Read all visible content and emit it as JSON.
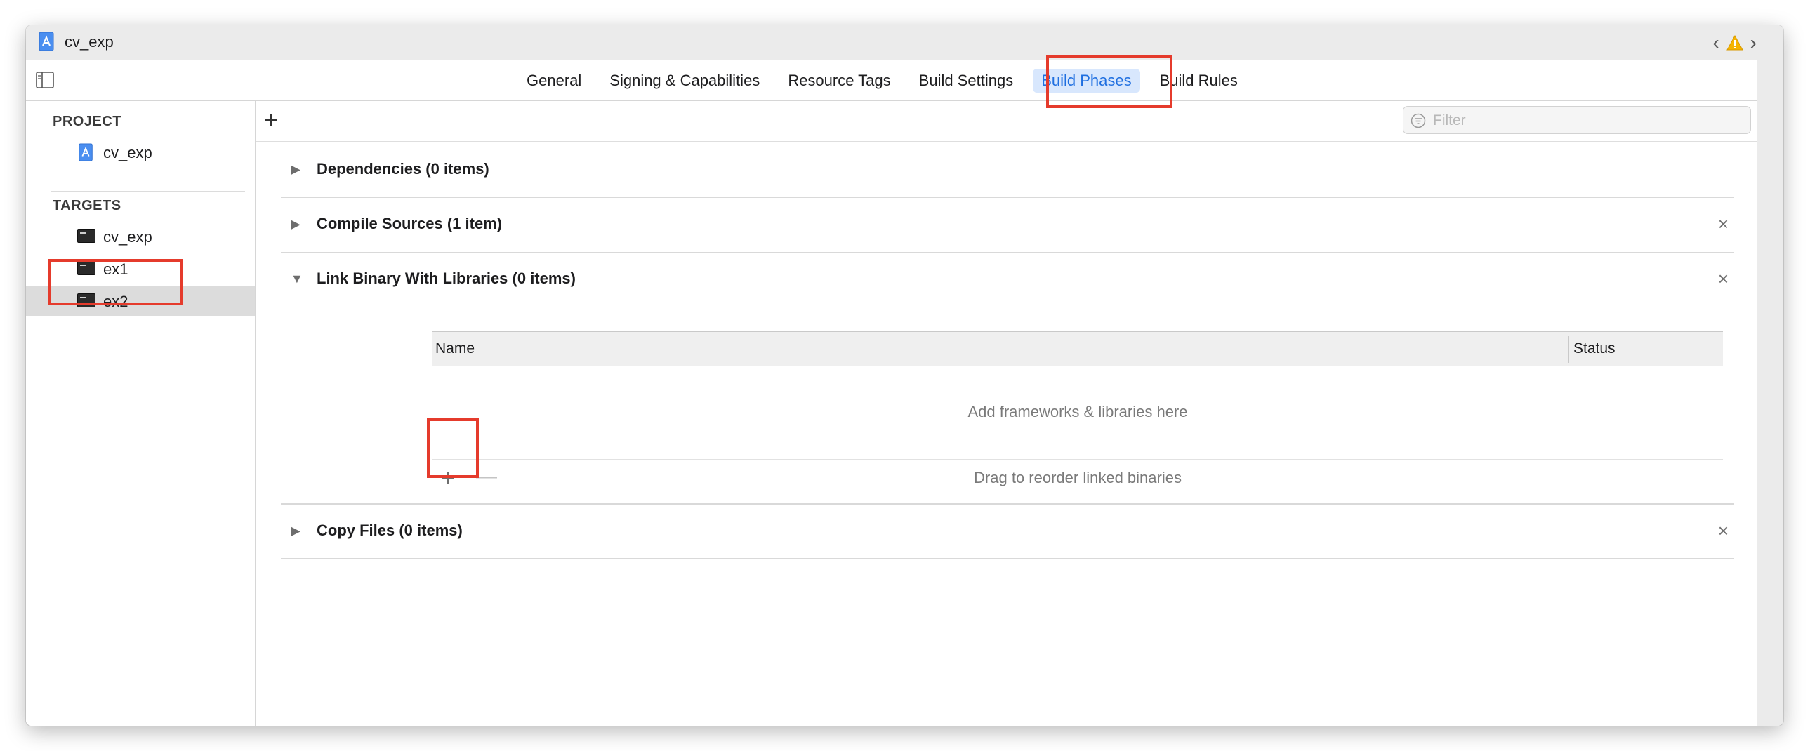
{
  "window": {
    "title": "cv_exp"
  },
  "tabs": [
    {
      "label": "General"
    },
    {
      "label": "Signing & Capabilities"
    },
    {
      "label": "Resource Tags"
    },
    {
      "label": "Build Settings"
    },
    {
      "label": "Build Phases",
      "active": true
    },
    {
      "label": "Build Rules"
    }
  ],
  "sidebar": {
    "project_header": "PROJECT",
    "project_item": {
      "label": "cv_exp",
      "icon": "xcode-project-icon"
    },
    "targets_header": "TARGETS",
    "targets": [
      {
        "label": "cv_exp",
        "icon": "terminal-target-icon"
      },
      {
        "label": "ex1",
        "icon": "terminal-target-icon"
      },
      {
        "label": "ex2",
        "icon": "terminal-target-icon",
        "selected": true
      }
    ]
  },
  "toolbar": {
    "add_label": "+",
    "filter_placeholder": "Filter",
    "filter_icon": "filter-icon"
  },
  "phases": {
    "dependencies": {
      "title": "Dependencies (0 items)",
      "expanded": false
    },
    "compile_sources": {
      "title": "Compile Sources (1 item)",
      "expanded": false,
      "removable": true
    },
    "link_binary": {
      "title": "Link Binary With Libraries (0 items)",
      "expanded": true,
      "removable": true,
      "columns": {
        "name": "Name",
        "status": "Status"
      },
      "empty_text": "Add frameworks & libraries here",
      "drag_text": "Drag to reorder linked binaries",
      "add_label": "+",
      "remove_label": "—"
    },
    "copy_files": {
      "title": "Copy Files (0 items)",
      "expanded": false,
      "removable": true
    }
  },
  "icons": {
    "disclosure_collapsed": "▶",
    "disclosure_expanded": "▼",
    "close": "×",
    "nav_back": "‹",
    "nav_forward": "›",
    "warning": "warning-icon"
  },
  "colors": {
    "accent": "#1f6fe0",
    "active_tab_bg": "#d8e7fd",
    "highlight_box": "#e53b2c",
    "selection": "#dcdcdc"
  }
}
